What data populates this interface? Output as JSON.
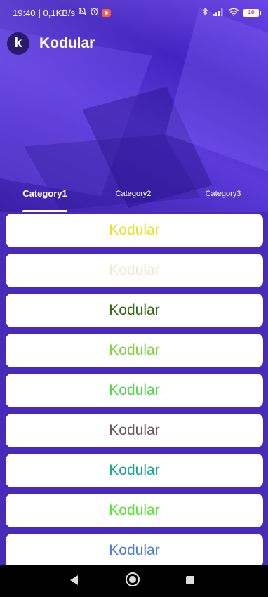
{
  "status_bar": {
    "time": "19:40",
    "speed": "| 0,1KB/s",
    "icons": [
      "mute-bell-icon",
      "alarm-icon",
      "screen-record-icon",
      "bluetooth-icon",
      "signal-icon",
      "wifi-icon"
    ],
    "battery_level": "16"
  },
  "app_bar": {
    "logo_letter": "k",
    "title": "Kodular"
  },
  "tabs": [
    {
      "label": "Category1",
      "active": true
    },
    {
      "label": "Category2",
      "active": false
    },
    {
      "label": "Category3",
      "active": false
    }
  ],
  "items": [
    {
      "label": "Kodular",
      "color": "#e9e22a"
    },
    {
      "label": "Kodular",
      "color": "#ecebd6"
    },
    {
      "label": "Kodular",
      "color": "#2f6b0a"
    },
    {
      "label": "Kodular",
      "color": "#7fd23a"
    },
    {
      "label": "Kodular",
      "color": "#4fd84a"
    },
    {
      "label": "Kodular",
      "color": "#6a5560"
    },
    {
      "label": "Kodular",
      "color": "#13a888"
    },
    {
      "label": "Kodular",
      "color": "#4fe82a"
    },
    {
      "label": "Kodular",
      "color": "#4a7fd8"
    }
  ],
  "nav_bar": {
    "icons": [
      "back-icon",
      "home-icon",
      "recents-icon"
    ]
  }
}
